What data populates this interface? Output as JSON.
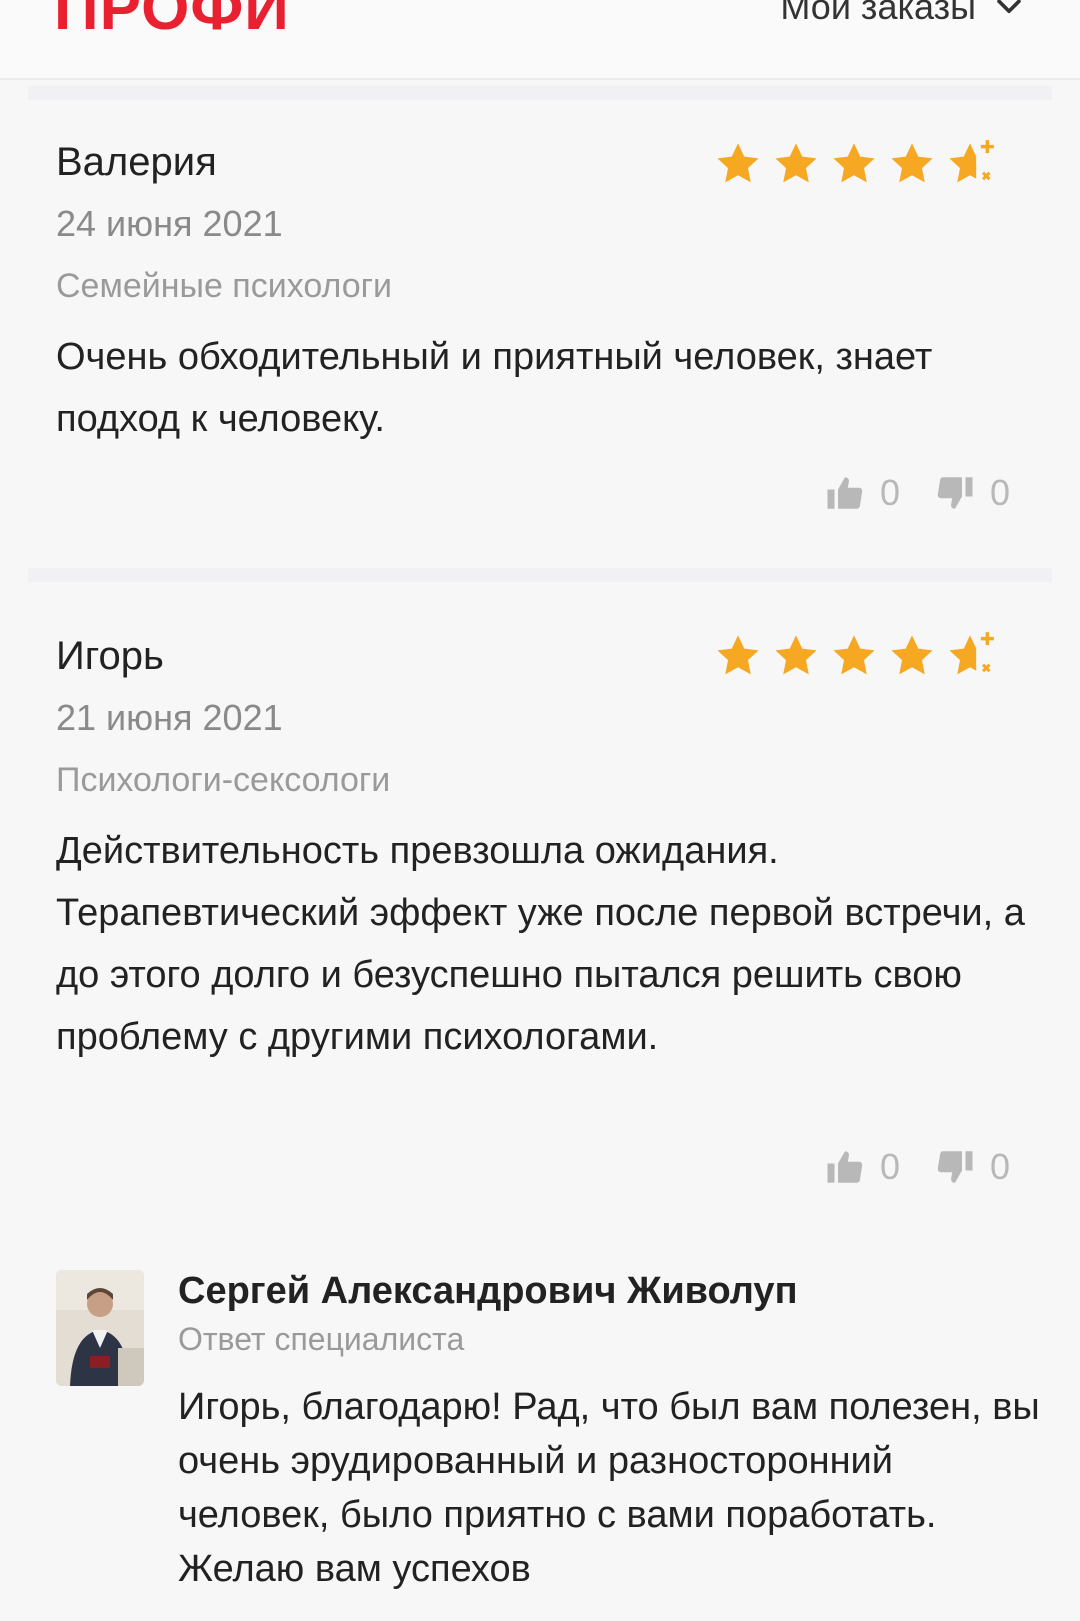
{
  "header": {
    "logo": "ПРОФИ",
    "orders_label": "Мои заказы"
  },
  "colors": {
    "brand": "#e8202f",
    "star": "#f7a823",
    "muted": "#8a8a8a"
  },
  "reviews": [
    {
      "author": "Валерия",
      "date": "24 июня 2021",
      "category": "Семейные психологи",
      "rating": 4.5,
      "text": "Очень обходительный и приятный человек, знает подход к человеку.",
      "likes": "0",
      "dislikes": "0"
    },
    {
      "author": "Игорь",
      "date": "21 июня 2021",
      "category": "Психологи-сексологи",
      "rating": 4.5,
      "text": "Действительность превзошла ожидания. Терапевтический эффект уже после первой встречи, а до этого долго и безуспешно пытался решить свою проблему с другими психологами.",
      "likes": "0",
      "dislikes": "0",
      "reply": {
        "name": "Сергей Александрович Живолуп",
        "role": "Ответ специалиста",
        "text": "Игорь, благодарю! Рад, что был вам полезен, вы очень эрудированный и разносторонний человек, было приятно с вами поработать. Желаю вам успехов"
      }
    }
  ]
}
